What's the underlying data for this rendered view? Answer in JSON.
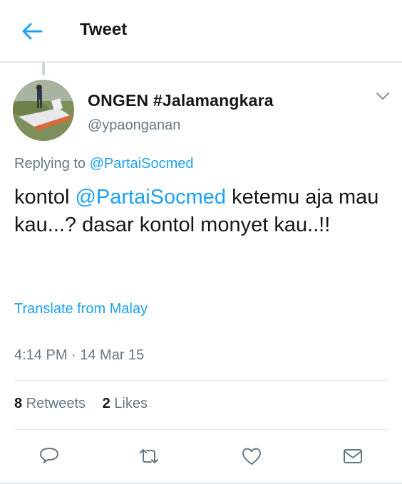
{
  "header": {
    "title": "Tweet",
    "back_icon": "arrow-left-icon"
  },
  "tweet": {
    "display_name": "ONGEN #Jalamangkara",
    "handle": "@ypaonganan",
    "replying_prefix": "Replying to ",
    "replying_to": "@PartaiSocmed",
    "text_before": "kontol ",
    "mention": "@PartaiSocmed",
    "text_after": " ketemu aja mau kau...? dasar kontol monyet kau..!!",
    "translate_label": "Translate from Malay",
    "timestamp": "4:14 PM · 14 Mar 15"
  },
  "stats": {
    "retweets_count": "8",
    "retweets_label": " Retweets",
    "likes_count": "2",
    "likes_label": " Likes"
  },
  "actions": [
    "reply-icon",
    "retweet-icon",
    "like-icon",
    "share-icon"
  ],
  "colors": {
    "accent": "#1da1f2",
    "secondary_text": "#657786",
    "border": "#e1e8ed"
  }
}
